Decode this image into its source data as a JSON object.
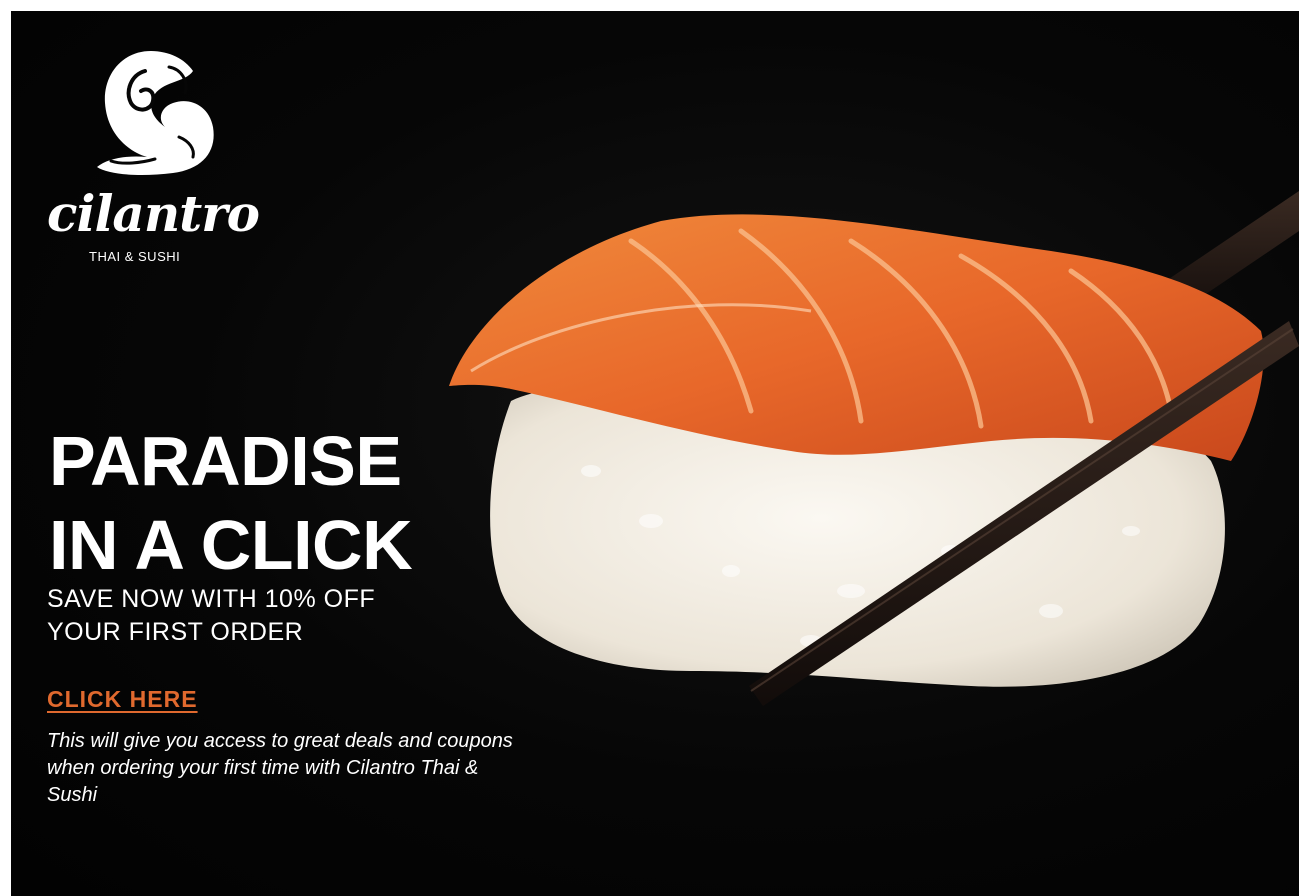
{
  "brand": {
    "name": "cilantro",
    "tagline": "THAI & SUSHI"
  },
  "hero": {
    "headline_line1": "PARADISE",
    "headline_line2": "IN A CLICK",
    "subhead_line1": "SAVE NOW WITH 10% OFF",
    "subhead_line2": "YOUR FIRST ORDER",
    "cta_label": "CLICK HERE",
    "description": "This will give you access to great deals and coupons when ordering your first time with Cilantro Thai & Sushi"
  },
  "colors": {
    "background": "#050505",
    "text": "#ffffff",
    "accent": "#e0692e",
    "salmon": "#e8702a",
    "rice": "#f4efe6",
    "chopsticks": "#1a1210"
  },
  "icons": {
    "logo": "cilantro-swirl-logo-icon"
  }
}
